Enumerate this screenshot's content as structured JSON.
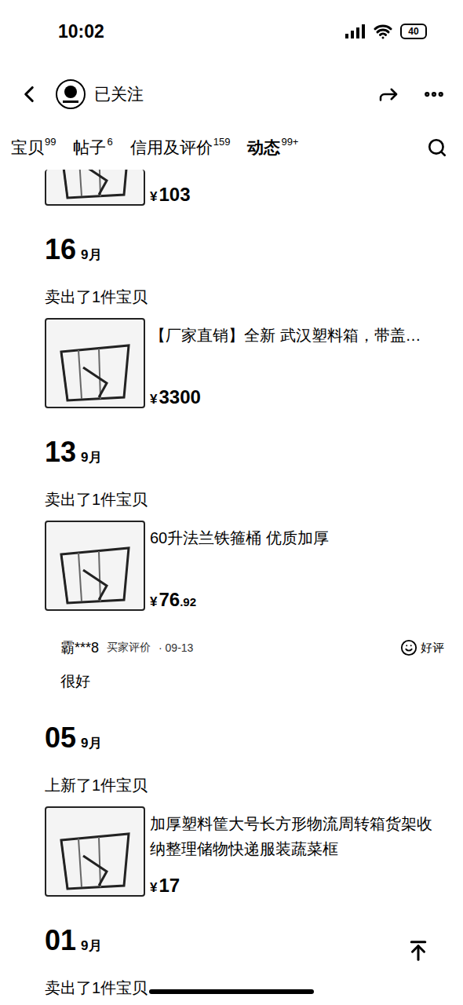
{
  "status_bar": {
    "time": "10:02",
    "battery": "40"
  },
  "header": {
    "follow_label": "已关注"
  },
  "tabs": [
    {
      "label": "宝贝",
      "count": "99",
      "selected": false
    },
    {
      "label": "帖子",
      "count": "6",
      "selected": false
    },
    {
      "label": "信用及评价",
      "count": "159",
      "selected": false
    },
    {
      "label": "动态",
      "count": "99+",
      "selected": true
    }
  ],
  "feed": [
    {
      "kind": "partial",
      "item": {
        "currency": "¥",
        "amount": "103"
      }
    },
    {
      "kind": "full",
      "day": "16",
      "month": "9月",
      "action": "卖出了1件宝贝",
      "item": {
        "title": "【厂家直销】全新 武汉塑料箱，带盖…",
        "currency": "¥",
        "amount": "3300"
      }
    },
    {
      "kind": "full",
      "day": "13",
      "month": "9月",
      "action": "卖出了1件宝贝",
      "item": {
        "title": "60升法兰铁箍桶 优质加厚",
        "currency": "¥",
        "amount": "76",
        "cents": ".92"
      },
      "review": {
        "user": "霸***8",
        "label": "买家评价",
        "date": "· 09-13",
        "rating": "好评",
        "text": "很好"
      }
    },
    {
      "kind": "full",
      "day": "05",
      "month": "9月",
      "action": "上新了1件宝贝",
      "item": {
        "title": "加厚塑料筐大号长方形物流周转箱货架收纳整理储物快递服装蔬菜框",
        "currency": "¥",
        "amount": "17"
      }
    },
    {
      "kind": "header-only",
      "day": "01",
      "month": "9月",
      "action": "卖出了1件宝贝"
    }
  ]
}
